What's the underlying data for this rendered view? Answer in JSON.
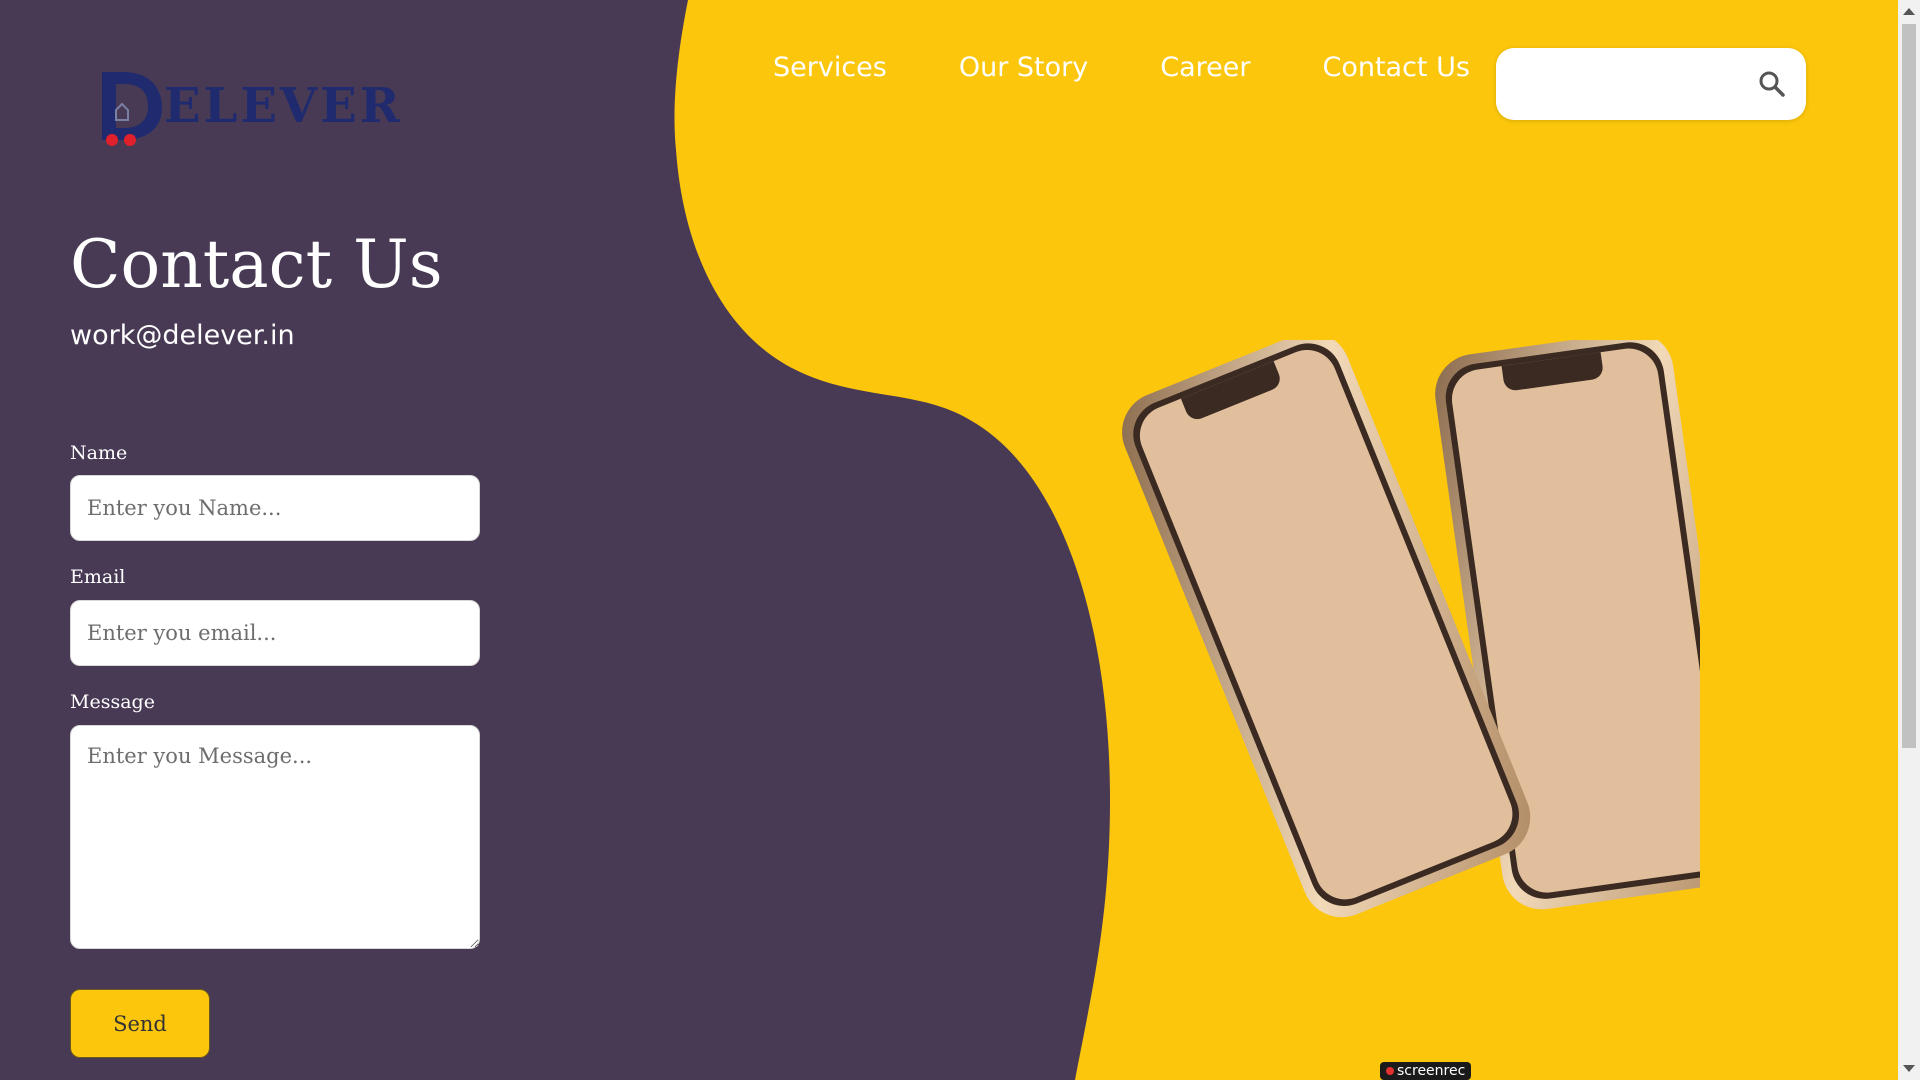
{
  "colors": {
    "purple": "#483a54",
    "yellow": "#fbc60b",
    "logo_blue": "#1f2b6e",
    "logo_red": "#e0202a"
  },
  "logo": {
    "text": "ELEVER",
    "initial_letter": "D"
  },
  "nav": {
    "items": [
      "Services",
      "Our Story",
      "Career",
      "Contact Us"
    ]
  },
  "search": {
    "placeholder": "",
    "icon": "search-icon"
  },
  "contact": {
    "title": "Contact Us",
    "email": "work@delever.in"
  },
  "form": {
    "name_label": "Name",
    "name_placeholder": "Enter you Name...",
    "email_label": "Email",
    "email_placeholder": "Enter you email...",
    "message_label": "Message",
    "message_placeholder": "Enter you Message...",
    "send_label": "Send"
  },
  "watermark": {
    "text": "screenrec"
  }
}
